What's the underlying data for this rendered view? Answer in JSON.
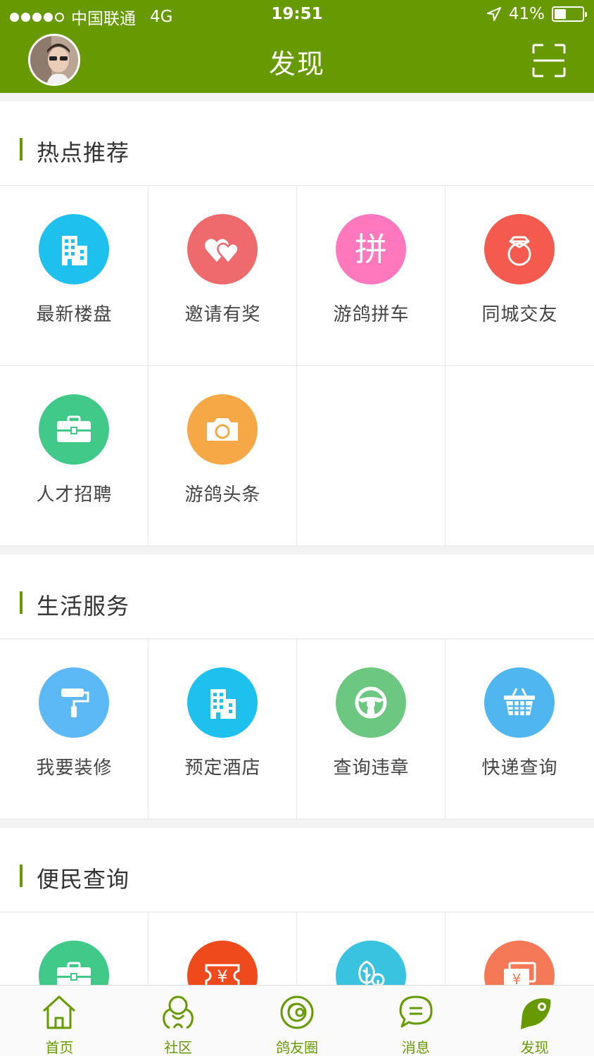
{
  "status_bar": {
    "carrier": "中国联通",
    "network": "4G",
    "time": "19:51",
    "battery": "41%",
    "battery_level": 0.41
  },
  "nav": {
    "title": "发现",
    "avatar": "user-avatar",
    "right_icon": "scan-icon"
  },
  "colors": {
    "brand": "#679a00"
  },
  "sections": [
    {
      "title": "热点推荐",
      "items": [
        {
          "label": "最新楼盘",
          "icon": "building-icon",
          "color": "#1ec1ee"
        },
        {
          "label": "邀请有奖",
          "icon": "hearts-icon",
          "color": "#ef6a6c"
        },
        {
          "label": "游鸽拼车",
          "icon": "pin-character-icon",
          "color": "#ff78bd",
          "glyph": "拼"
        },
        {
          "label": "同城交友",
          "icon": "ring-icon",
          "color": "#f45b4e"
        },
        {
          "label": "人才招聘",
          "icon": "briefcase-icon",
          "color": "#41c98a"
        },
        {
          "label": "游鸽头条",
          "icon": "camera-icon",
          "color": "#f5a845"
        }
      ]
    },
    {
      "title": "生活服务",
      "items": [
        {
          "label": "我要装修",
          "icon": "paint-roller-icon",
          "color": "#5cb9f5"
        },
        {
          "label": "预定酒店",
          "icon": "building-icon",
          "color": "#1ec1ee"
        },
        {
          "label": "查询违章",
          "icon": "steering-wheel-icon",
          "color": "#6cc881"
        },
        {
          "label": "快递查询",
          "icon": "basket-icon",
          "color": "#4fb6f0"
        }
      ]
    },
    {
      "title": "便民查询",
      "items": [
        {
          "label": "",
          "icon": "briefcase-icon",
          "color": "#41c98a"
        },
        {
          "label": "",
          "icon": "ticket-yuan-icon",
          "color": "#ef4a1c"
        },
        {
          "label": "",
          "icon": "trees-icon",
          "color": "#39c3e0"
        },
        {
          "label": "",
          "icon": "coupon-yuan-icon",
          "color": "#f57957"
        }
      ]
    }
  ],
  "tabbar": [
    {
      "label": "首页",
      "icon": "home-icon"
    },
    {
      "label": "社区",
      "icon": "community-icon"
    },
    {
      "label": "鸽友圈",
      "icon": "circle-icon"
    },
    {
      "label": "消息",
      "icon": "message-icon"
    },
    {
      "label": "发现",
      "icon": "discover-icon",
      "active": true
    }
  ]
}
